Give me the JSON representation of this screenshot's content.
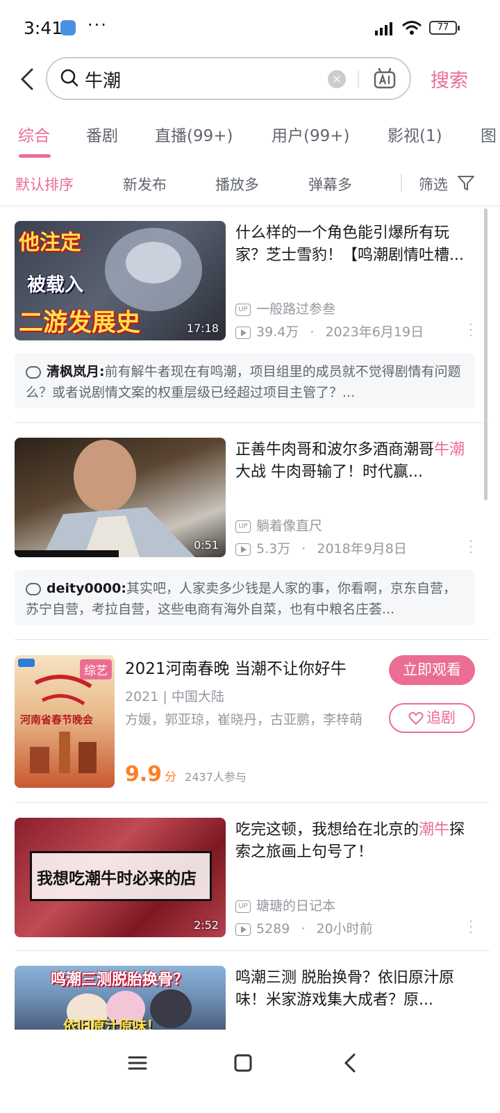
{
  "status_bar": {
    "time": "3:41",
    "dots": "···",
    "battery": "77"
  },
  "search": {
    "query": "牛潮",
    "clear_glyph": "×",
    "button_label": "搜索"
  },
  "tabs": [
    "综合",
    "番剧",
    "直播(99+)",
    "用户(99+)",
    "影视(1)",
    "图"
  ],
  "sort_options": [
    "默认排序",
    "新发布",
    "播放多",
    "弹幕多"
  ],
  "filter_label": "筛选",
  "accent_color": "#eb6d94",
  "results": [
    {
      "thumb_text": [
        "他注定",
        "被载入",
        "二游发展史"
      ],
      "duration": "17:18",
      "title": "什么样的一个角色能引爆所有玩家？芝士雪豹！【鸣潮剧情吐槽...",
      "author": "一般路过参叁",
      "views": "39.4万",
      "date": "2023年6月19日",
      "comment_user": "清枫岚月:",
      "comment_text": "前有解牛者现在有鸣潮，项目组里的成员就不觉得剧情有问题么？或者说剧情文案的权重层级已经超过项目主管了？..."
    },
    {
      "duration": "0:51",
      "title_parts": [
        "正善牛肉哥和波尔多酒商潮哥",
        "牛潮",
        "大战 牛肉哥输了！时代赢..."
      ],
      "author": "躺着像直尺",
      "views": "5.3万",
      "date": "2018年9月8日",
      "comment_user": "deity0000:",
      "comment_text": "其实吧，人家卖多少钱是人家的事，你看啊，京东自营，苏宁自营，考拉自营，这些电商有海外自菜，也有中粮名庄荟..."
    },
    {
      "poster_tag": "综艺",
      "poster_text": [
        "河南省春节晚会"
      ],
      "title": "2021河南春晚 当潮不让你好牛",
      "sub": "2021 | 中国大陆",
      "cast": "方媛，郭亚琼，崔晓丹，古亚鹏，李梓萌",
      "score": "9.9",
      "score_unit": "分",
      "participants": "2437人参与",
      "watch_label": "立即观看",
      "follow_label": "追剧"
    },
    {
      "thumb_text": "我想吃潮牛时必来的店",
      "duration": "2:52",
      "title_parts": [
        "吃完这顿，我想给在北京的",
        "潮牛",
        "探索之旅画上句号了！"
      ],
      "author": "瑭瑭的日记本",
      "views": "5289",
      "date": "20小时前"
    },
    {
      "thumb_text": [
        "鸣潮三测脱胎换骨？",
        "依旧原汁原味！"
      ],
      "title": "鸣潮三测 脱胎换骨？依旧原汁原味！米家游戏集大成者？原..."
    }
  ],
  "up_badge": "UP",
  "separator": "·"
}
